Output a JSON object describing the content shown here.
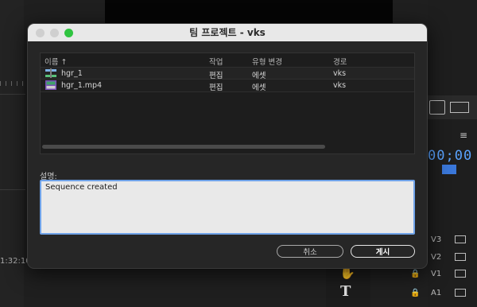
{
  "background": {
    "timecode": "00;00",
    "left_timecode": "1:32:10",
    "menu_icon": "hamburger-icon",
    "tracks": [
      {
        "name": "V3"
      },
      {
        "name": "V2"
      },
      {
        "name": "V1"
      },
      {
        "name": "A1"
      }
    ],
    "tools": {
      "hand": "hand-icon",
      "text": "T"
    }
  },
  "dialog": {
    "title": "팀 프로젝트 - vks",
    "columns": {
      "name": "이름 ↑",
      "work": "작업",
      "type": "유형 변경",
      "path": "경로"
    },
    "rows": [
      {
        "icon": "sequence-icon",
        "name": "hgr_1",
        "work": "편집",
        "type": "에셋",
        "path": "vks"
      },
      {
        "icon": "video-clip-icon",
        "name": "hgr_1.mp4",
        "work": "편집",
        "type": "에셋",
        "path": "vks"
      }
    ],
    "description_label": "설명:",
    "description_value": "Sequence created",
    "cancel_label": "취소",
    "post_label": "게시"
  }
}
